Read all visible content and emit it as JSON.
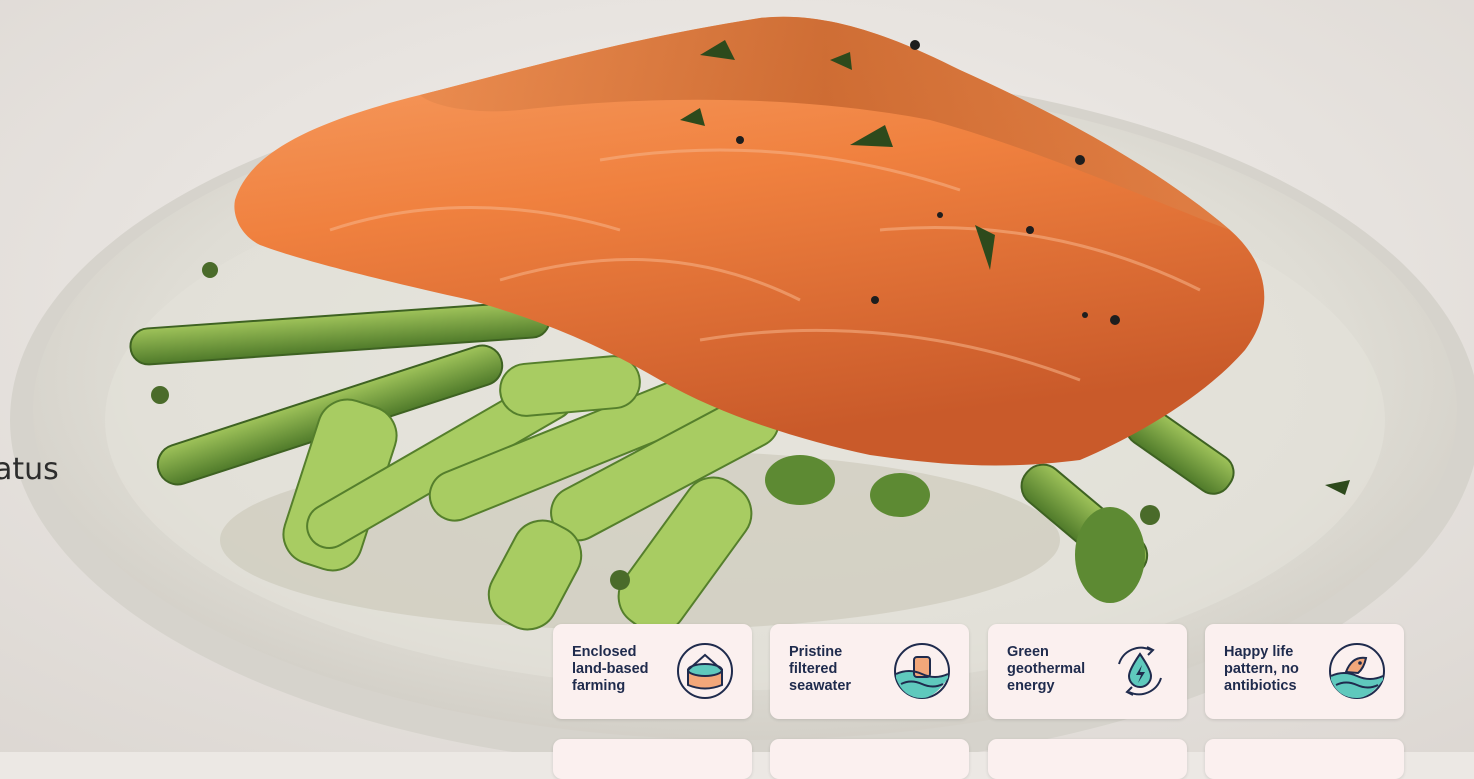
{
  "partial_side_text": "atus",
  "badges": [
    {
      "label": "Enclosed\nland-based\nfarming",
      "icon": "tank-icon"
    },
    {
      "label": "Pristine\nfiltered\nseawater",
      "icon": "seawater-icon"
    },
    {
      "label": "Green\ngeothermal\nenergy",
      "icon": "geothermal-energy-icon"
    },
    {
      "label": "Happy life\npattern, no\nantibiotics",
      "icon": "fish-waves-icon"
    }
  ],
  "colors": {
    "badge_bg": "#fbf0ef",
    "badge_text": "#1f2b4d",
    "icon_teal": "#5fc9bd",
    "icon_orange": "#f2a77a",
    "icon_navy": "#1f2b4d"
  }
}
